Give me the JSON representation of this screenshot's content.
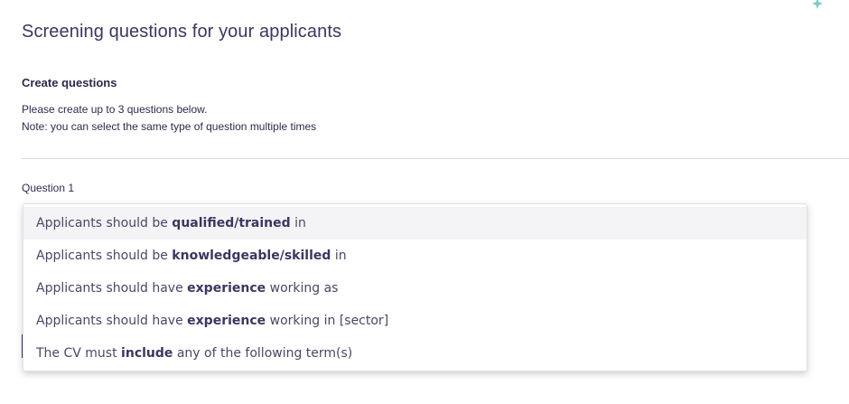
{
  "page": {
    "title": "Screening questions for your applicants"
  },
  "create": {
    "heading": "Create questions",
    "instruction_line1": "Please create up to 3 questions below.",
    "instruction_line2": "Note: you can select the same type of question multiple times"
  },
  "question": {
    "label": "Question 1"
  },
  "dropdown": {
    "options": [
      {
        "pre": "Applicants should be ",
        "bold": "qualified/trained",
        "post": " in"
      },
      {
        "pre": "Applicants should be ",
        "bold": "knowledgeable/skilled",
        "post": " in"
      },
      {
        "pre": "Applicants should have ",
        "bold": "experience",
        "post": " working as"
      },
      {
        "pre": "Applicants should have ",
        "bold": "experience",
        "post": " working in [sector]"
      },
      {
        "pre": "The CV must ",
        "bold": "include",
        "post": " any of the following term(s)"
      }
    ],
    "highlighted_index": 0
  },
  "icons": {
    "sparkle": "sparkle-icon"
  },
  "colors": {
    "text_primary": "#2e2a4a",
    "title": "#3b3760",
    "sparkle": "#7fc9c4",
    "highlight": "#f4f4f6"
  }
}
